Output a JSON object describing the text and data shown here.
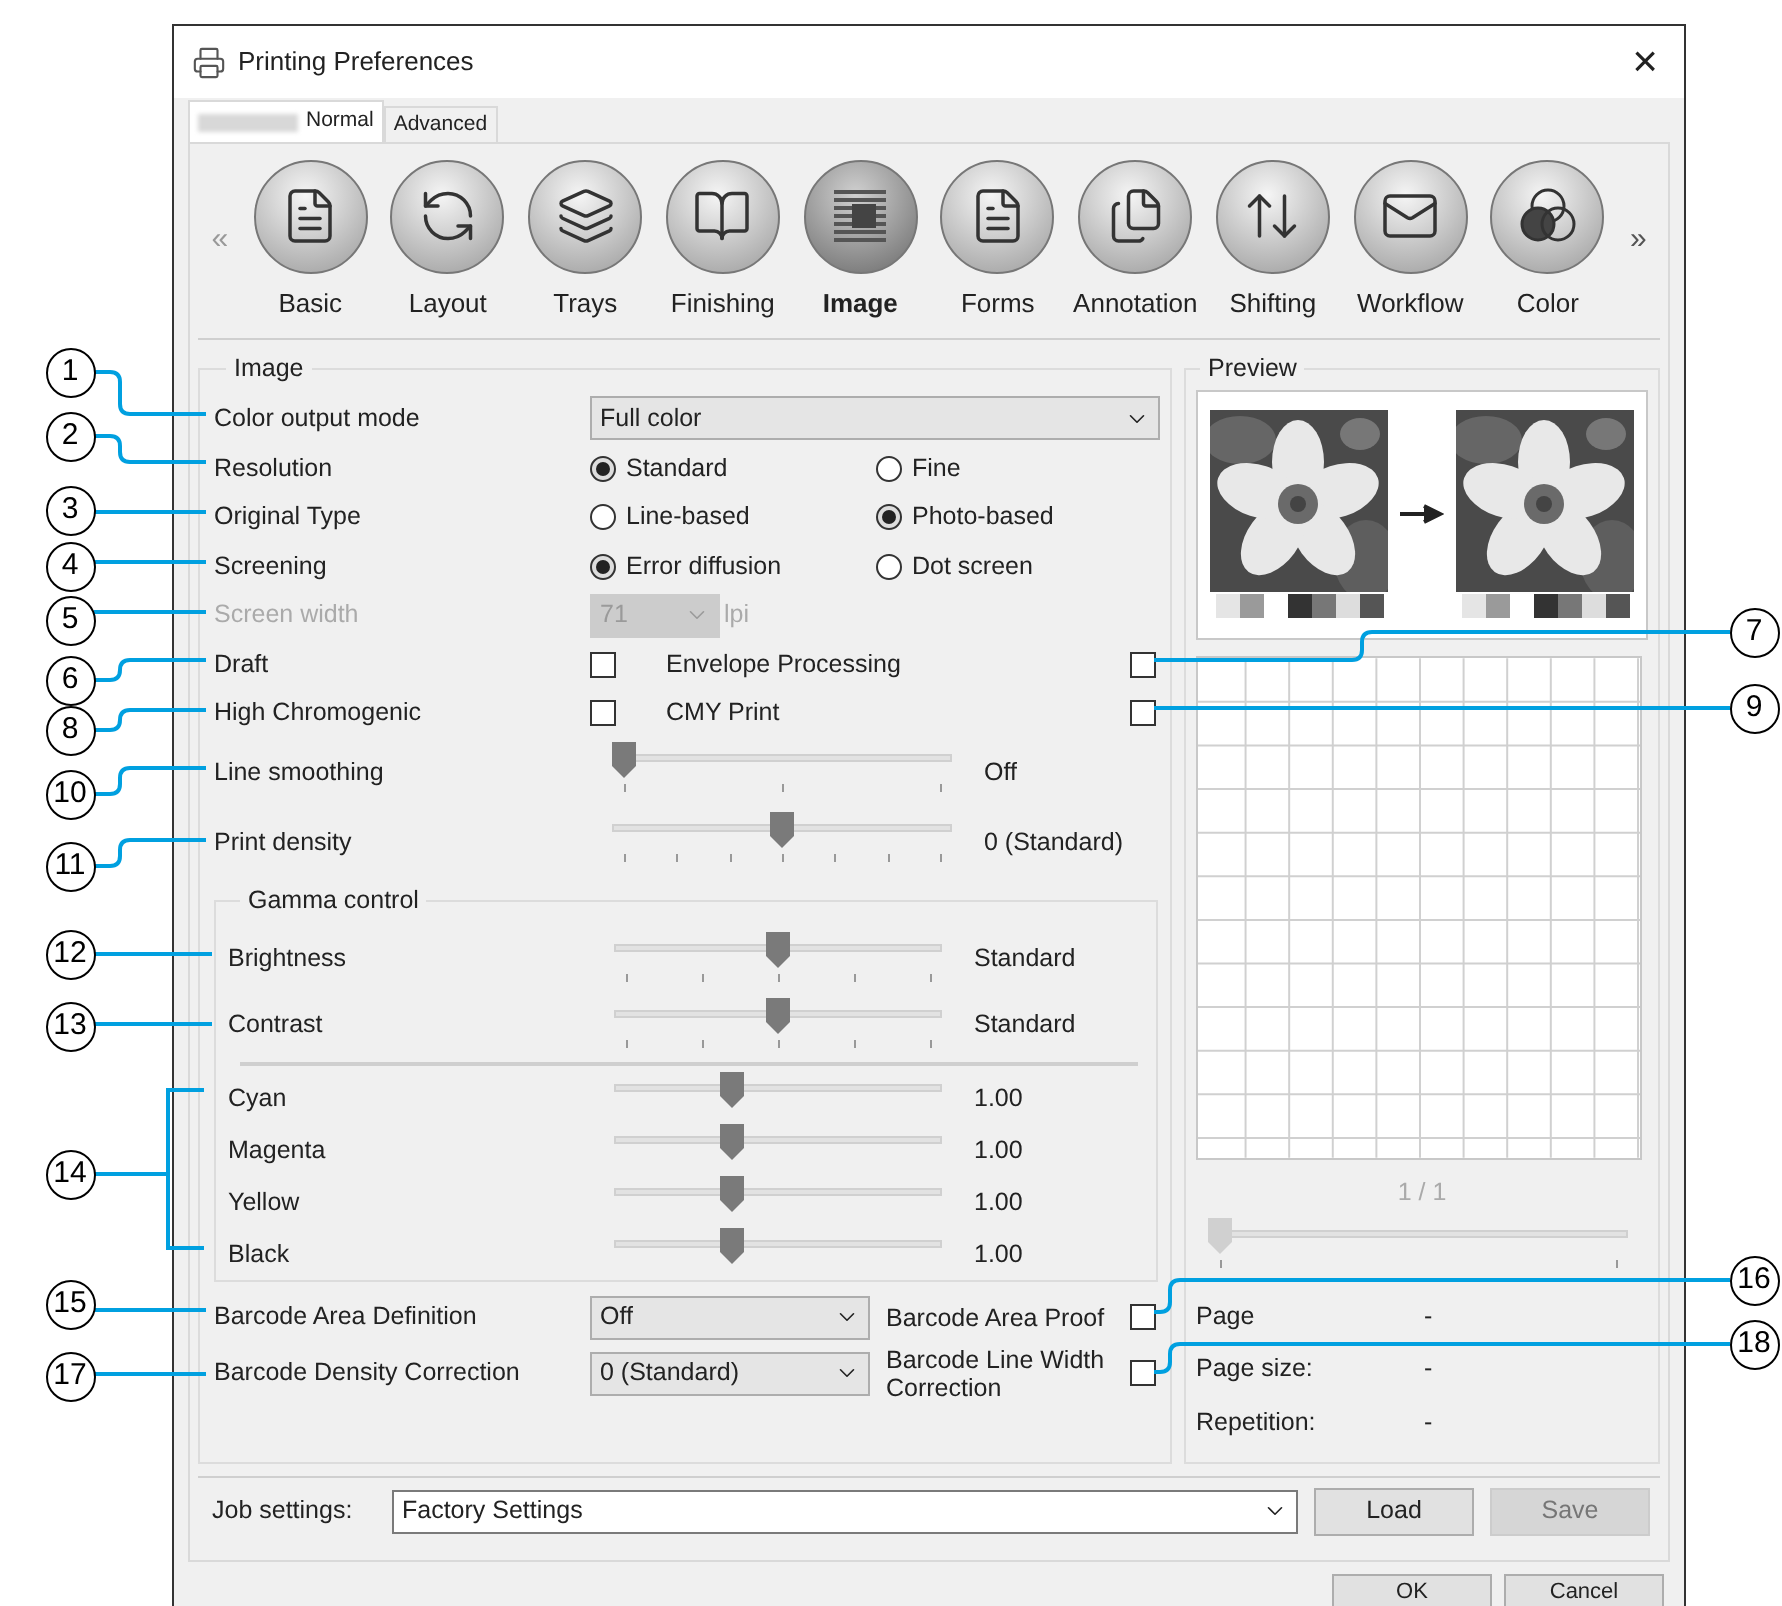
{
  "window": {
    "title": "Printing Preferences",
    "close": "×"
  },
  "tabs": [
    {
      "label": "Normal",
      "selected": true,
      "redacted": true
    },
    {
      "label": "Advanced",
      "selected": false,
      "redacted": false
    }
  ],
  "nav": {
    "prev": "«",
    "next": "»"
  },
  "categories": [
    {
      "label": "Basic",
      "selected": false
    },
    {
      "label": "Layout",
      "selected": false
    },
    {
      "label": "Trays",
      "selected": false
    },
    {
      "label": "Finishing",
      "selected": false
    },
    {
      "label": "Image",
      "selected": true
    },
    {
      "label": "Forms",
      "selected": false
    },
    {
      "label": "Annotation",
      "selected": false
    },
    {
      "label": "Shifting",
      "selected": false
    },
    {
      "label": "Workflow",
      "selected": false
    },
    {
      "label": "Color",
      "selected": false
    }
  ],
  "image_group": {
    "title": "Image",
    "rows": [
      {
        "kind": "dropdown",
        "label": "Color output mode",
        "value": "Full color"
      },
      {
        "kind": "radio",
        "label": "Resolution",
        "options": [
          {
            "label": "Standard",
            "selected": true
          },
          {
            "label": "Fine",
            "selected": false
          }
        ]
      },
      {
        "kind": "radio",
        "label": "Original Type",
        "options": [
          {
            "label": "Line-based",
            "selected": false
          },
          {
            "label": "Photo-based",
            "selected": true
          }
        ]
      },
      {
        "kind": "radio",
        "label": "Screening",
        "options": [
          {
            "label": "Error diffusion",
            "selected": true
          },
          {
            "label": "Dot screen",
            "selected": false
          }
        ]
      },
      {
        "kind": "spin",
        "label": "Screen width",
        "value": "71",
        "unit": "lpi",
        "disabled": true
      },
      {
        "kind": "checks",
        "label": "Draft",
        "checked": false,
        "label_2": "Envelope Processing",
        "checked_2": false
      },
      {
        "kind": "checks",
        "label": "High Chromogenic",
        "checked": false,
        "label_2": "CMY Print",
        "checked_2": false
      },
      {
        "kind": "slider",
        "label": "Line smoothing",
        "level": 0,
        "reading": "Off"
      },
      {
        "kind": "slider",
        "label": "Print density",
        "level": 0.5,
        "reading": "0 (Standard)"
      }
    ]
  },
  "gamma": {
    "title": "Gamma control",
    "sliders": [
      {
        "label": "Brightness",
        "level": 0.5,
        "reading": "Standard"
      },
      {
        "label": "Contrast",
        "level": 0.5,
        "reading": "Standard"
      }
    ],
    "color_sliders": [
      {
        "label": "Cyan",
        "level": 0.35,
        "reading": "1.00"
      },
      {
        "label": "Magenta",
        "level": 0.35,
        "reading": "1.00"
      },
      {
        "label": "Yellow",
        "level": 0.35,
        "reading": "1.00"
      },
      {
        "label": "Black",
        "level": 0.35,
        "reading": "1.00"
      }
    ]
  },
  "barcode_rows": [
    {
      "label": "Barcode Area Definition",
      "value": "Off",
      "check_label": "Barcode Area Proof",
      "checked": false
    },
    {
      "label": "Barcode Density Correction",
      "value": "0 (Standard)",
      "check_label": "Barcode Line Width Correction",
      "checked": false
    }
  ],
  "preview": {
    "title": "Preview",
    "page_indicator": "1 / 1",
    "slider": {
      "level": 0,
      "disabled": true
    },
    "info": [
      {
        "label": "Page",
        "value": "-"
      },
      {
        "label": "Page size:",
        "value": "-"
      },
      {
        "label": "Repetition:",
        "value": "-"
      }
    ]
  },
  "job_settings": {
    "label": "Job settings:",
    "value": "Factory Settings"
  },
  "job_buttons": [
    {
      "label": "Load",
      "disabled": false
    },
    {
      "label": "Save",
      "disabled": true
    }
  ],
  "dialog_buttons": [
    {
      "label": "OK"
    },
    {
      "label": "Cancel"
    }
  ],
  "left_callouts": [
    {
      "number": "1"
    },
    {
      "number": "2"
    },
    {
      "number": "3"
    },
    {
      "number": "4"
    },
    {
      "number": "5"
    },
    {
      "number": "6"
    },
    {
      "number": "8"
    },
    {
      "number": "10"
    },
    {
      "number": "11"
    },
    {
      "number": "12"
    },
    {
      "number": "13"
    },
    {
      "number": "14"
    },
    {
      "number": "15"
    },
    {
      "number": "17"
    }
  ],
  "right_callouts": [
    {
      "number": "7"
    },
    {
      "number": "9"
    },
    {
      "number": "16"
    },
    {
      "number": "18"
    }
  ]
}
